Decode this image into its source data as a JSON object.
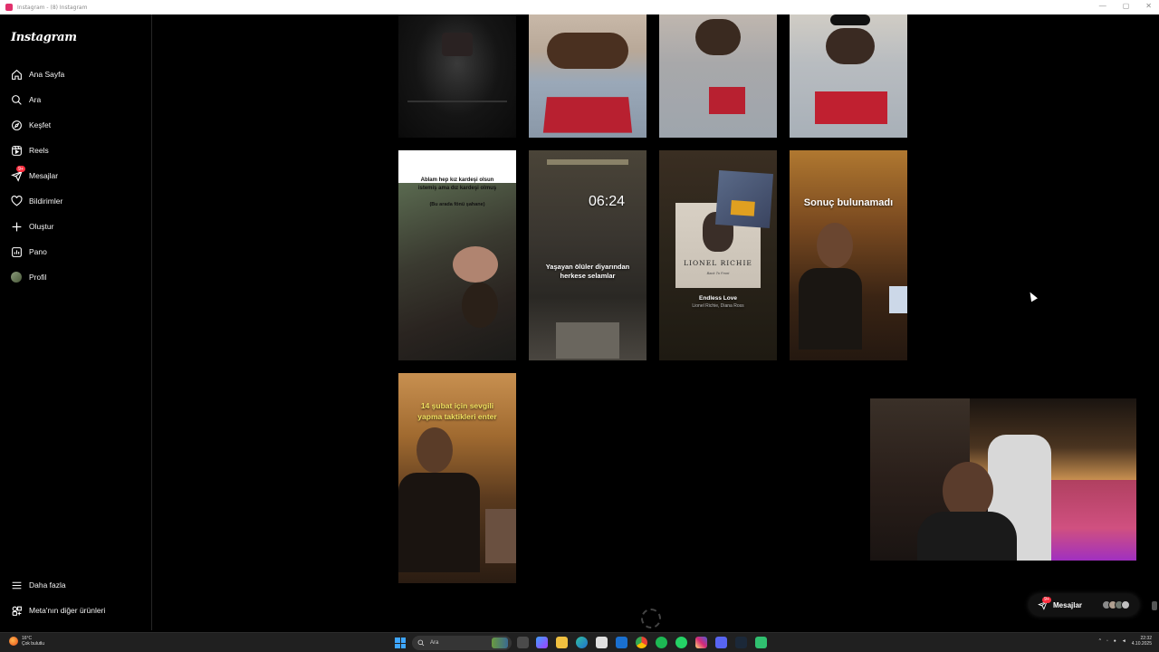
{
  "window": {
    "title": "Instagram - (8) Instagram"
  },
  "sidebar": {
    "logo": "Instagram",
    "items": [
      {
        "label": "Ana Sayfa",
        "icon": "home-icon"
      },
      {
        "label": "Ara",
        "icon": "search-icon"
      },
      {
        "label": "Keşfet",
        "icon": "compass-icon"
      },
      {
        "label": "Reels",
        "icon": "reels-icon"
      },
      {
        "label": "Mesajlar",
        "icon": "messenger-icon",
        "badge": "9+"
      },
      {
        "label": "Bildirimler",
        "icon": "heart-icon"
      },
      {
        "label": "Oluştur",
        "icon": "plus-icon"
      },
      {
        "label": "Pano",
        "icon": "dashboard-icon"
      },
      {
        "label": "Profil",
        "icon": "avatar-icon"
      }
    ],
    "bottom": [
      {
        "label": "Daha fazla",
        "icon": "menu-icon"
      },
      {
        "label": "Meta'nın diğer ürünleri",
        "icon": "meta-grid-icon"
      }
    ]
  },
  "grid": {
    "row2": {
      "tile1": {
        "line1": "Ablam hep kız kardeşi olsun",
        "line2": "istemiş ama dız kardeşi olmuş",
        "line3": "(Bu arada fönü şahane)"
      },
      "tile2": {
        "time": "06:24",
        "caption": "Yaşayan ölüler diyarından herkese selamlar"
      },
      "tile3": {
        "album": "LIONEL RICHIE",
        "album_sub": "Back To Front",
        "song": "Endless Love",
        "artist": "Lionel Richie, Diana Ross"
      },
      "tile4": {
        "caption": "Sonuç bulunamadı"
      }
    },
    "row3": {
      "tile1": {
        "caption": "14 şubat için sevgili yapma taktikleri enter"
      }
    }
  },
  "messages_pill": {
    "label": "Mesajlar",
    "badge": "9+"
  },
  "taskbar": {
    "weather_temp": "16°C",
    "weather_desc": "Çok bulutlu",
    "search_label": "Ara",
    "time": "22:32",
    "date": "4.10.2025"
  },
  "colors": {
    "background": "#000000",
    "badge": "#ff3040",
    "accent": "#3ea6ff"
  }
}
